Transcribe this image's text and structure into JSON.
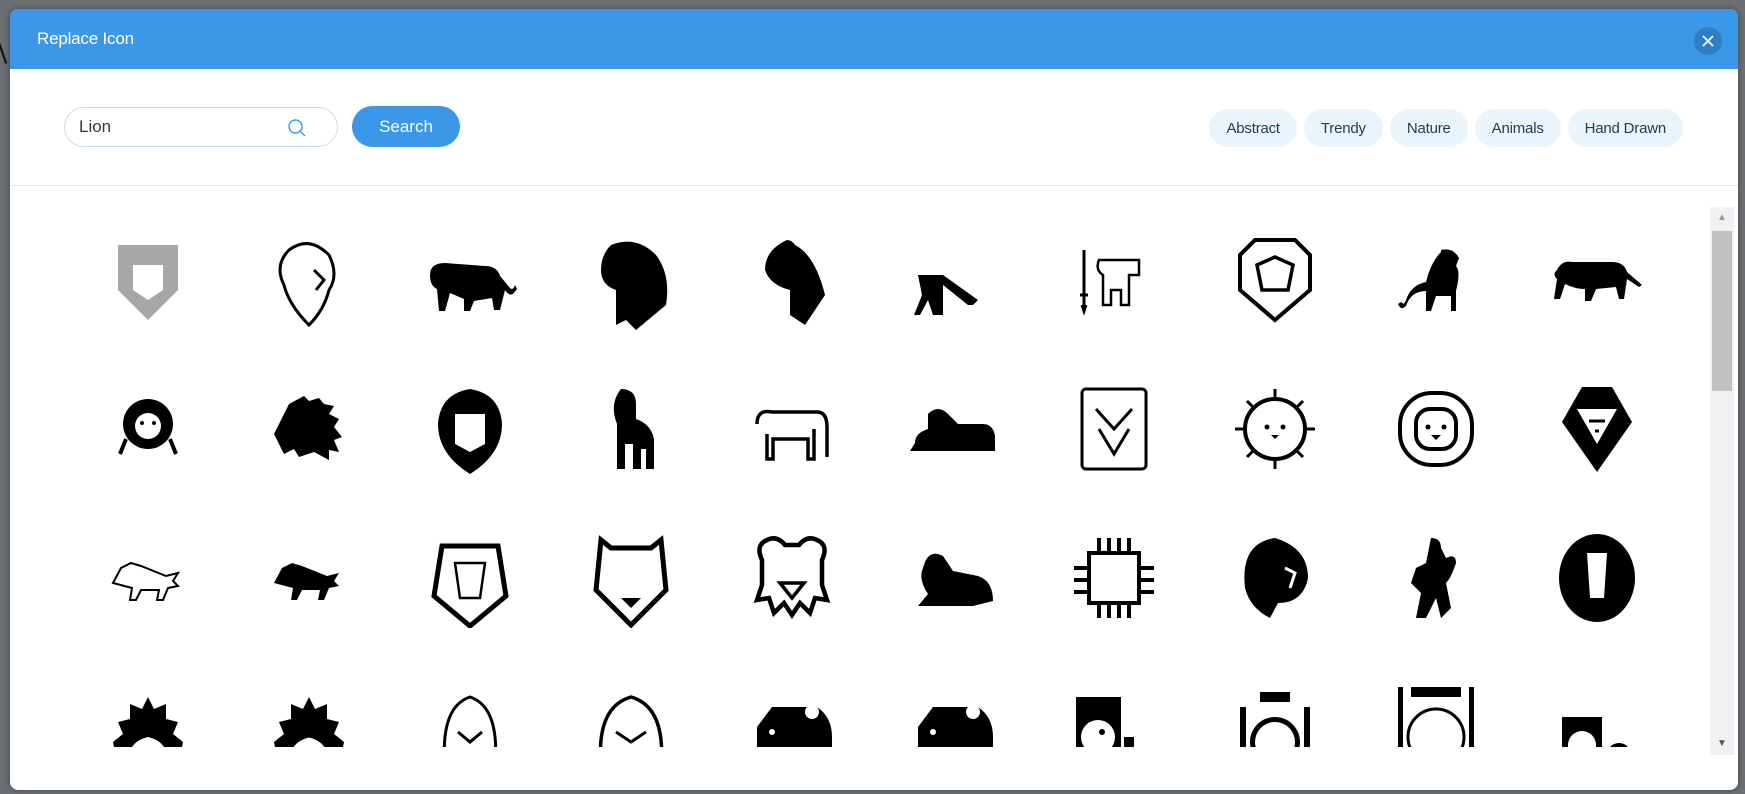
{
  "dialog": {
    "title": "Replace Icon",
    "close_icon": "close-icon"
  },
  "search": {
    "value": "Lion",
    "placeholder": "",
    "icon": "search-icon",
    "button_label": "Search"
  },
  "categories": [
    {
      "label": "Abstract"
    },
    {
      "label": "Trendy"
    },
    {
      "label": "Nature"
    },
    {
      "label": "Animals"
    },
    {
      "label": "Hand Drawn"
    }
  ],
  "results": [
    {
      "name": "lion-shield-geometric-icon",
      "selected": true
    },
    {
      "name": "lion-roaring-head-outline-icon"
    },
    {
      "name": "lion-walking-silhouette-icon"
    },
    {
      "name": "lion-head-profile-silhouette-icon"
    },
    {
      "name": "lioness-head-profile-silhouette-icon"
    },
    {
      "name": "lion-geometric-walking-icon"
    },
    {
      "name": "sri-lanka-lion-sword-icon"
    },
    {
      "name": "lion-hexagon-face-outline-icon"
    },
    {
      "name": "lion-standing-silhouette-icon"
    },
    {
      "name": "lioness-walking-silhouette-icon"
    },
    {
      "name": "lion-cub-face-icon"
    },
    {
      "name": "lion-spiky-mane-head-icon"
    },
    {
      "name": "lion-face-mane-icon"
    },
    {
      "name": "lion-standing-front-icon"
    },
    {
      "name": "lion-line-standing-icon"
    },
    {
      "name": "lion-lying-statue-icon"
    },
    {
      "name": "lion-face-framed-icon"
    },
    {
      "name": "lion-sun-face-icon"
    },
    {
      "name": "lion-round-face-icon"
    },
    {
      "name": "lion-triangle-mane-icon"
    },
    {
      "name": "lion-sketch-outline-icon"
    },
    {
      "name": "lion-sketch-silhouette-icon"
    },
    {
      "name": "lion-pentagon-face-icon"
    },
    {
      "name": "cheetah-face-outline-icon"
    },
    {
      "name": "lion-cartoon-face-outline-icon"
    },
    {
      "name": "lion-lying-silhouette-icon"
    },
    {
      "name": "lion-circuit-face-icon"
    },
    {
      "name": "lion-tribal-mane-icon"
    },
    {
      "name": "lion-rampant-heraldic-icon"
    },
    {
      "name": "lion-sunburst-oval-icon"
    },
    {
      "name": "lion-spiky-mane-cartoon-icon"
    },
    {
      "name": "lion-spiky-mane-face-icon"
    },
    {
      "name": "lion-cub-outline-face-icon"
    },
    {
      "name": "lion-cartoon-eyes-face-icon"
    },
    {
      "name": "lion-abstract-block-icon"
    },
    {
      "name": "lion-abstract-block-2-icon"
    },
    {
      "name": "bear-cage-icon"
    },
    {
      "name": "bear-bars-icon"
    },
    {
      "name": "bear-bars-2-icon"
    },
    {
      "name": "bear-small-cage-icon"
    }
  ],
  "scrollbar": {
    "position_fraction": 0.0,
    "visible_fraction": 0.27
  }
}
